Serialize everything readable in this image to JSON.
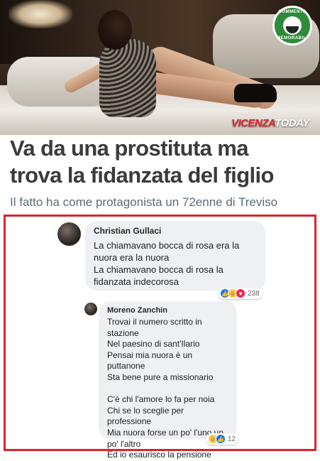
{
  "header": {
    "badge": {
      "top_text": "COMMENTS",
      "bottom_text": "MEMORABILI"
    },
    "brand": {
      "part1": "VICENZA",
      "part2": "TODAY"
    }
  },
  "article": {
    "headline_line1": "Va da una prostituta ma",
    "headline_line2": "trova la fidanzata del figlio",
    "subtitle": "Il fatto ha come protagonista un 72enne di Treviso"
  },
  "comments": [
    {
      "author": "Christian Gullaci",
      "text": "La chiamavano bocca di rosa era la\nnuora era la nuora\nLa chiamavano bocca di rosa la\nfidanzata indecorosa",
      "reactions": {
        "icons": [
          "like-icon",
          "haha-icon",
          "love-icon"
        ],
        "count": "238"
      }
    },
    {
      "author": "Moreno Zanchin",
      "text": "Trovai il numero scritto in\nstazione\nNel paesino di sant'Ilario\nPensai mia nuora è un puttanone\nSta bene pure a missionario\n\nC'è chi l'amore lo fa per noia\nChi se lo sceglie per professione\nMia nuora forse un po' l'uno un\npo' l'altro\nEd io esaurisco la pensione",
      "reactions": {
        "icons": [
          "haha-icon",
          "like-icon"
        ],
        "count": "12"
      }
    }
  ],
  "colors": {
    "highlight_border": "#d9262a",
    "headline": "#3b3b3b",
    "subtitle": "#5b6c74",
    "bubble": "#eef0f3",
    "brand_red": "#e2262d",
    "badge_green": "#2e8b3a"
  }
}
